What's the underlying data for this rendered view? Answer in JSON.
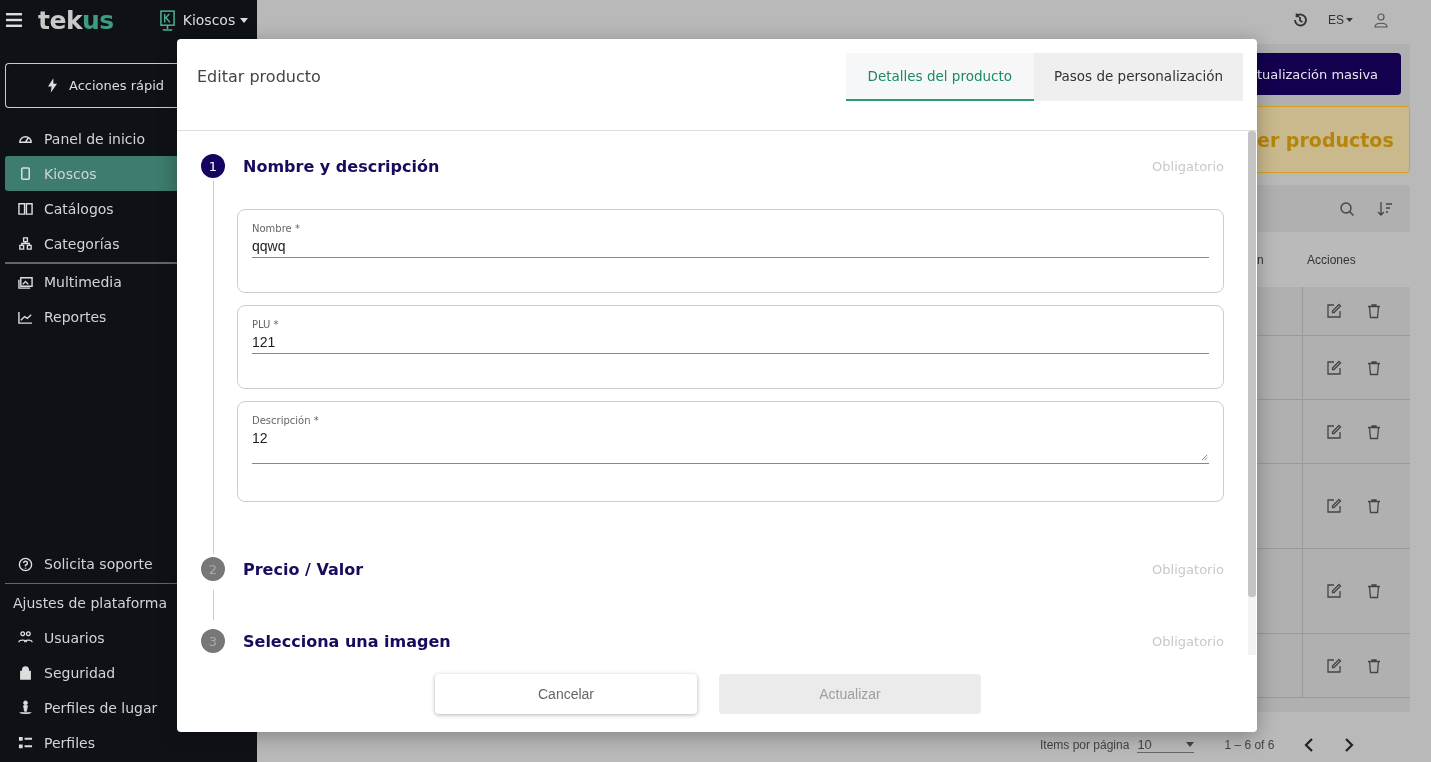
{
  "header": {
    "logo": [
      "tek",
      "us"
    ],
    "module": "Kioscos"
  },
  "quick_actions": "Acciones rápid",
  "nav_groups": [
    [
      {
        "label": "Panel de inicio",
        "selected": false
      },
      {
        "label": "Kioscos",
        "selected": true
      },
      {
        "label": "Catálogos",
        "selected": false
      },
      {
        "label": "Categorías",
        "selected": false
      }
    ],
    [
      {
        "label": "Multimedia",
        "selected": false
      },
      {
        "label": "Reportes",
        "selected": false
      }
    ]
  ],
  "support": "Solicita soporte",
  "settings": {
    "title": "Ajustes de plataforma",
    "items": [
      {
        "label": "Usuarios",
        "selected": false
      },
      {
        "label": "Seguridad",
        "selected": false
      },
      {
        "label": "Perfiles de lugar",
        "selected": false
      },
      {
        "label": "Perfiles",
        "selected": false
      }
    ]
  },
  "topbar": {
    "language": "ES"
  },
  "bulk_button": "tualización masiva",
  "banner": "er productos",
  "table": {
    "columns": [
      "n",
      "Acciones"
    ]
  },
  "pagination": {
    "label": "Items por página",
    "page_size": "10",
    "range": "1 – 6 of 6"
  },
  "modal": {
    "title": "Editar producto",
    "tabs": [
      {
        "label": "Detalles del producto",
        "selected": true
      },
      {
        "label": "Pasos de personalización",
        "selected": false
      }
    ],
    "steps": [
      {
        "number": "1",
        "title": "Nombre y descripción",
        "status": "Obligatorio",
        "active": true,
        "fields": [
          {
            "kind": "input",
            "label": "Nombre *",
            "value": "qqwq"
          },
          {
            "kind": "input",
            "label": "PLU *",
            "value": "121"
          },
          {
            "kind": "textarea",
            "label": "Descripción *",
            "value": "12"
          }
        ]
      },
      {
        "number": "2",
        "title": "Precio / Valor",
        "status": "Obligatorio",
        "active": false
      },
      {
        "number": "3",
        "title": "Selecciona una imagen",
        "status": "Obligatorio",
        "active": false
      }
    ],
    "buttons": [
      {
        "label": "Cancelar",
        "disabled": false
      },
      {
        "label": "Actualizar",
        "disabled": true
      }
    ]
  }
}
